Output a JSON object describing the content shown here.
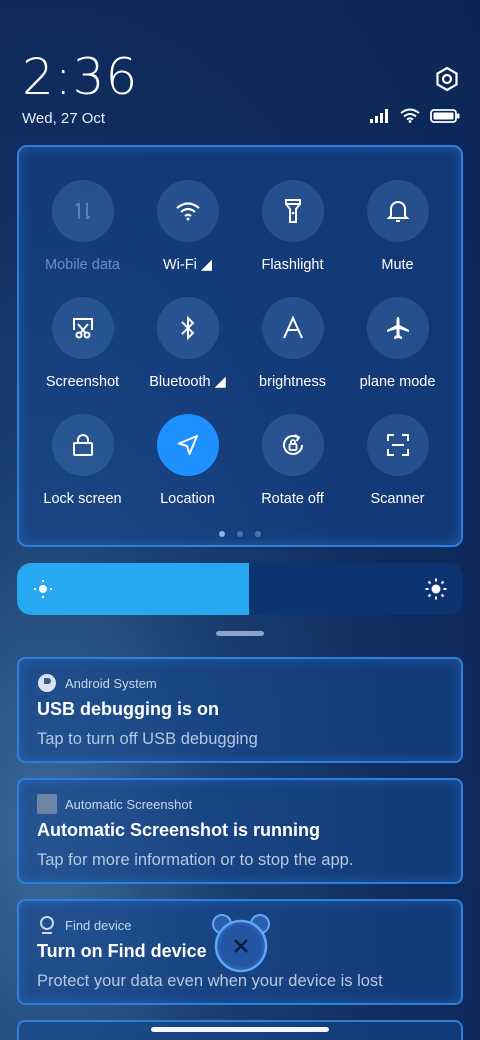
{
  "status": {
    "time": "2:36",
    "date": "Wed, 27 Oct",
    "icons": [
      "signal-icon",
      "wifi-icon",
      "battery-icon"
    ]
  },
  "quick_settings": {
    "tiles": [
      {
        "label": "Mobile data",
        "icon": "mobile-data-icon",
        "active": false,
        "disabled": true
      },
      {
        "label": "Wi-Fi ◢",
        "icon": "wifi-icon",
        "active": false
      },
      {
        "label": "Flashlight",
        "icon": "flashlight-icon",
        "active": false
      },
      {
        "label": "Mute",
        "icon": "bell-icon",
        "active": false
      },
      {
        "label": "Screenshot",
        "icon": "screenshot-icon",
        "active": false
      },
      {
        "label": "Bluetooth ◢",
        "icon": "bluetooth-icon",
        "active": false
      },
      {
        "label": "brightness",
        "icon": "auto-brightness-icon",
        "active": false
      },
      {
        "label": "plane mode",
        "icon": "airplane-icon",
        "active": false
      },
      {
        "label": "Lock screen",
        "icon": "lock-icon",
        "active": false
      },
      {
        "label": "Location",
        "icon": "location-icon",
        "active": true
      },
      {
        "label": "Rotate off",
        "icon": "rotate-lock-icon",
        "active": false
      },
      {
        "label": "Scanner",
        "icon": "scanner-icon",
        "active": false
      }
    ],
    "page_count": 3,
    "current_page": 1
  },
  "brightness": {
    "level": 0.52
  },
  "notifications": [
    {
      "app": "Android System",
      "title": "USB debugging is on",
      "body": "Tap to turn off USB debugging"
    },
    {
      "app": "Automatic Screenshot",
      "title": "Automatic Screenshot is running",
      "body": "Tap for more information or to stop the app."
    },
    {
      "app": "Find device",
      "title": "Turn on Find device",
      "body": "Protect your data even when your device is lost"
    }
  ],
  "colors": {
    "accent": "#1e90ff",
    "brightness_fill": "#26a9f0",
    "panel_border": "#2f7fd8"
  }
}
